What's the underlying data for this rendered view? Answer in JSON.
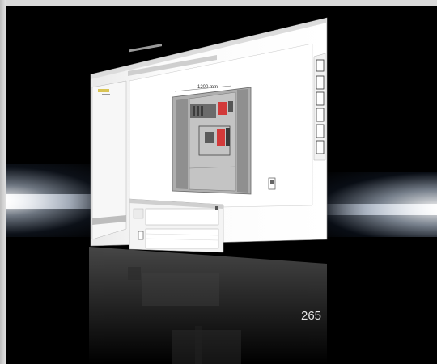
{
  "diagram": {
    "width_label": "1200 mm"
  },
  "page": {
    "number": "265"
  },
  "colors": {
    "background": "#000000",
    "frame": "#d9d9d9",
    "accent_red": "#d23a3a",
    "cabinet_gray": "#b0b0b0"
  }
}
